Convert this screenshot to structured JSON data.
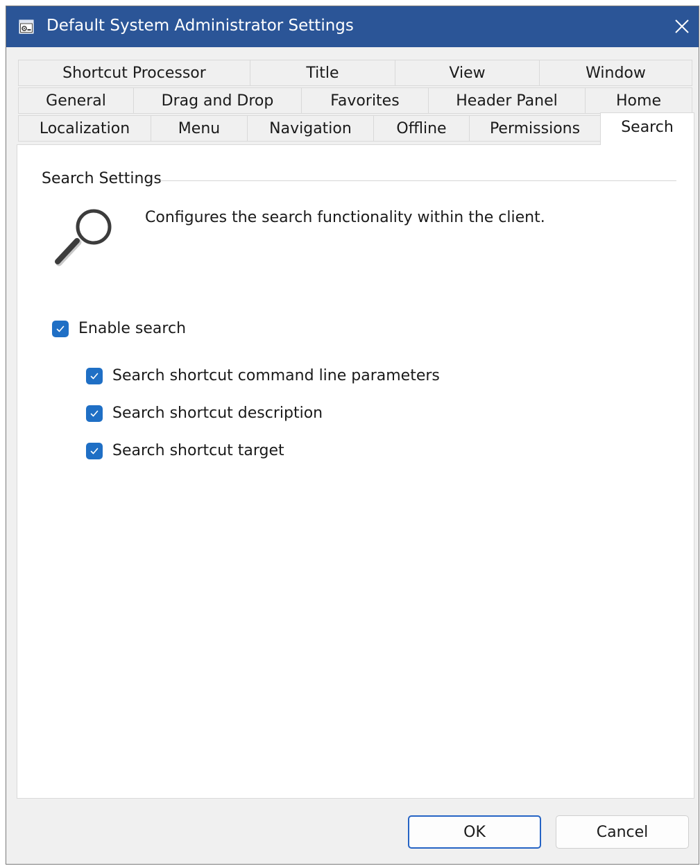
{
  "window": {
    "title": "Default System Administrator Settings",
    "title_icon": "settings-window-icon",
    "close_icon": "close-icon",
    "titlebar_color": "#2b5597"
  },
  "tabs": {
    "row1": [
      "Shortcut Processor",
      "Title",
      "View",
      "Window"
    ],
    "row2": [
      "General",
      "Drag and Drop",
      "Favorites",
      "Header Panel",
      "Home"
    ],
    "row3": [
      "Localization",
      "Menu",
      "Navigation",
      "Offline",
      "Permissions",
      "Search"
    ],
    "active": "Search"
  },
  "panel": {
    "group_title": "Search Settings",
    "icon": "magnifier-icon",
    "description": "Configures the search functionality within the client.",
    "enable_search": {
      "label": "Enable search",
      "checked": true
    },
    "options": [
      {
        "label": "Search shortcut command line parameters",
        "checked": true
      },
      {
        "label": "Search shortcut description",
        "checked": true
      },
      {
        "label": "Search shortcut target",
        "checked": true
      }
    ],
    "checkbox_color": "#1f6fc5"
  },
  "buttons": {
    "ok": "OK",
    "cancel": "Cancel",
    "accent": "#2563c4"
  }
}
